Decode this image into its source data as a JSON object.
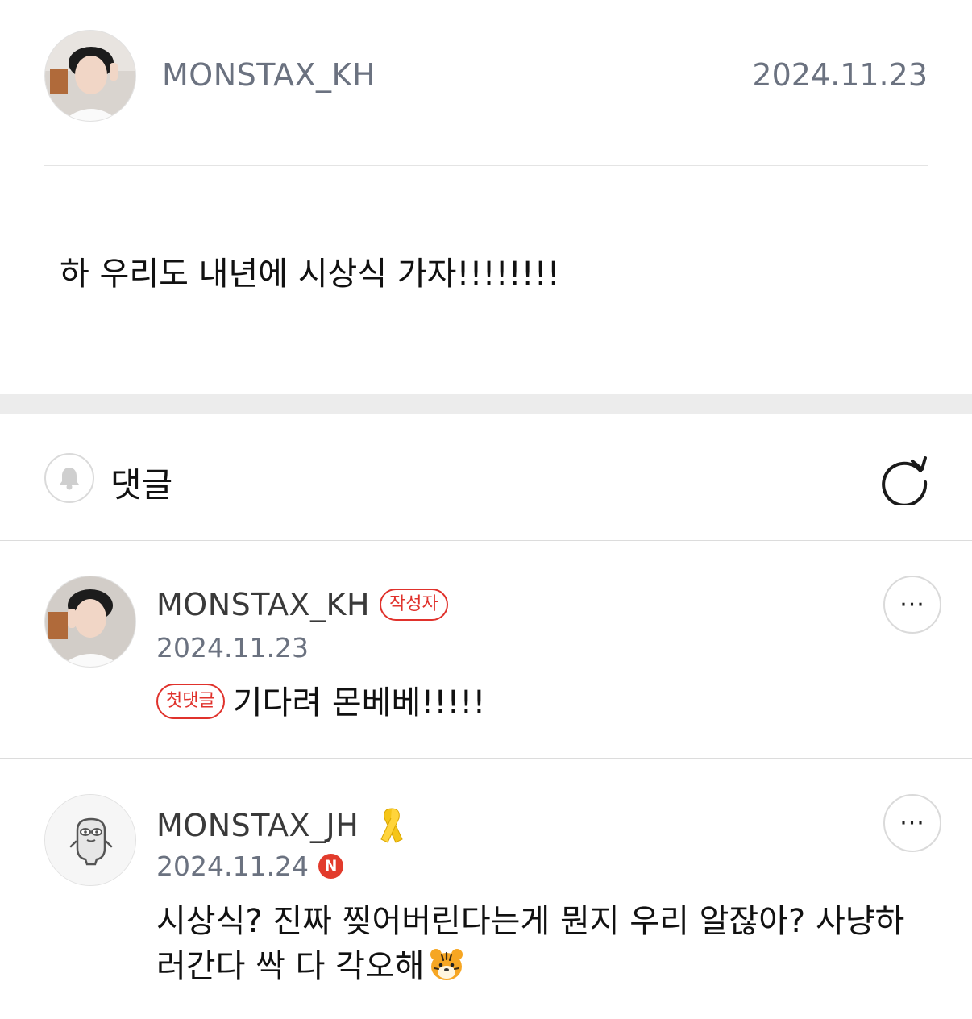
{
  "post": {
    "author": "MONSTAX_KH",
    "date": "2024.11.23",
    "body": "하 우리도 내년에 시상식 가자!!!!!!!!"
  },
  "comments_section": {
    "title": "댓글",
    "bell_icon": "bell-icon",
    "refresh_icon": "refresh-icon"
  },
  "comments": [
    {
      "author": "MONSTAX_KH",
      "badge": "작성자",
      "date": "2024.11.23",
      "first_badge": "첫댓글",
      "text": "기다려 몬베베!!!!!",
      "more_label": "···"
    },
    {
      "author": "MONSTAX_JH",
      "date": "2024.11.24",
      "n_badge": "N",
      "text_line1": "시상식? 진짜 찢어버린다는게 뭔지 우리 알잖아? 사냥하",
      "text_line2": "러간다 싹 다 각오해",
      "more_label": "···"
    }
  ],
  "colors": {
    "accent_red": "#e0322c",
    "muted_text": "#6b7280",
    "divider": "#dcdcdc",
    "section_gap": "#ececec"
  }
}
